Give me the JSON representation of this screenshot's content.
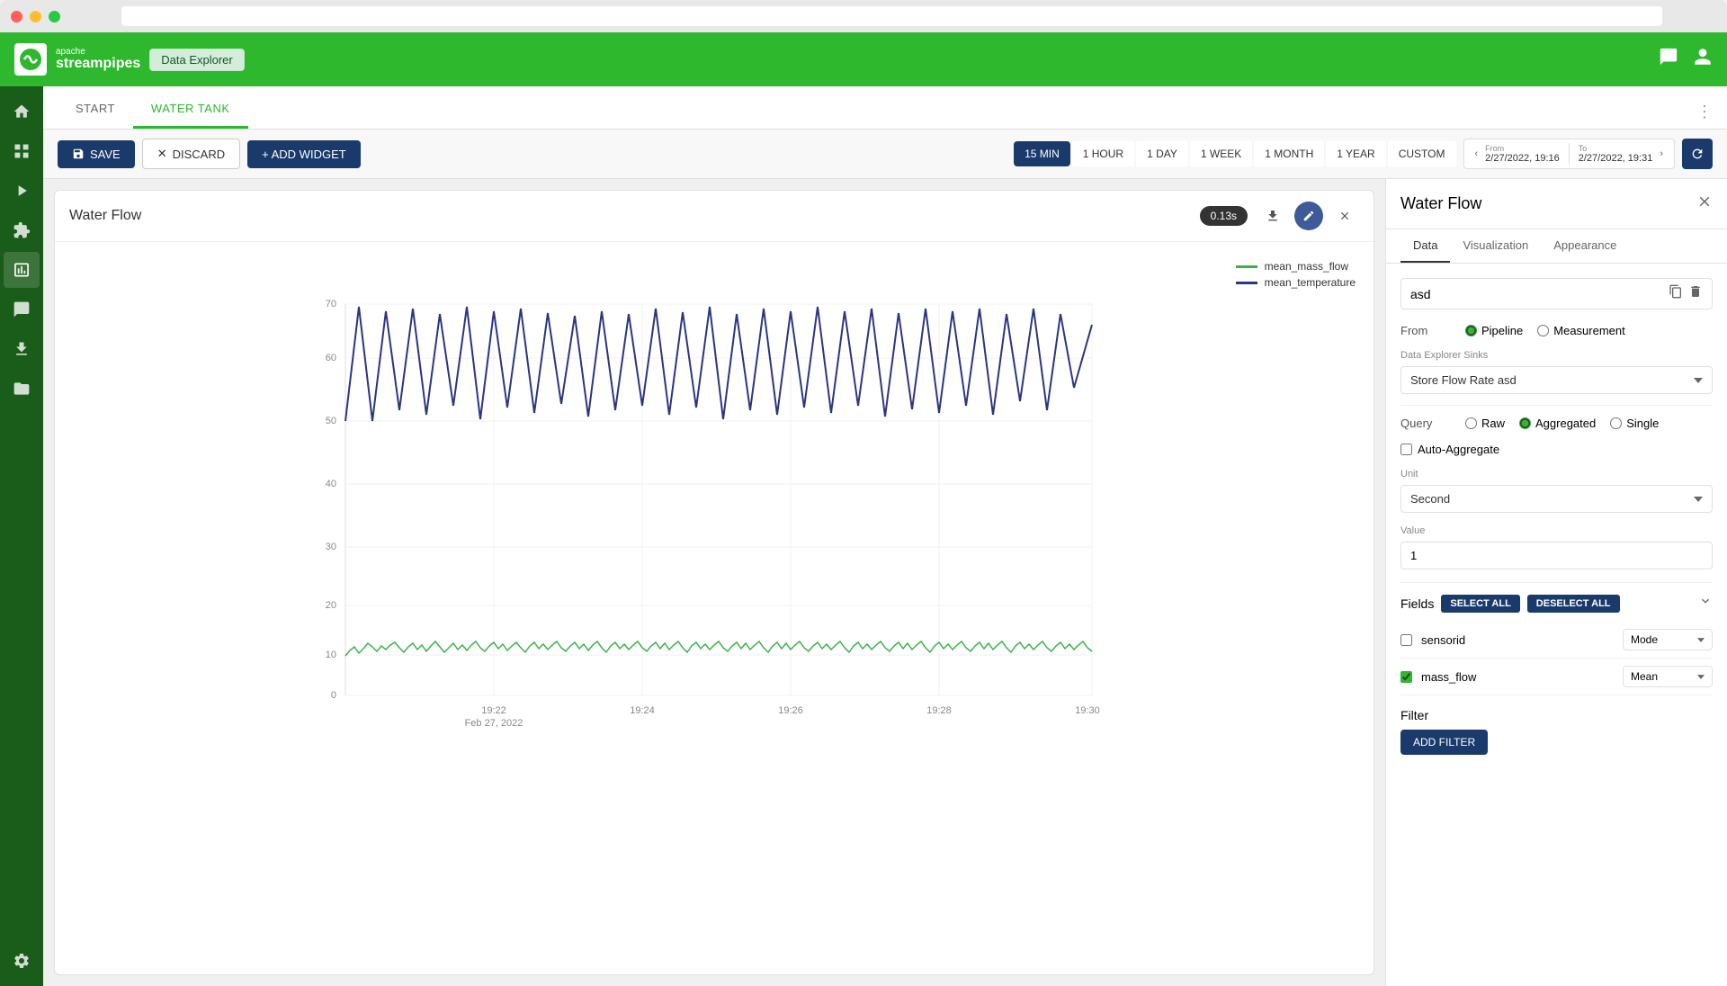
{
  "window": {
    "address": ""
  },
  "header": {
    "logo_letter": "S",
    "logo_apache": "apache",
    "logo_streampipes": "streampipes",
    "nav_badge": "Data Explorer",
    "chat_icon": "💬",
    "user_icon": "👤"
  },
  "sidebar": {
    "items": [
      {
        "name": "home-icon",
        "icon": "⌂"
      },
      {
        "name": "grid-icon",
        "icon": "⊞"
      },
      {
        "name": "play-icon",
        "icon": "▶"
      },
      {
        "name": "plugin-icon",
        "icon": "⬡"
      },
      {
        "name": "chart-icon",
        "icon": "📊"
      },
      {
        "name": "message-icon",
        "icon": "💬"
      },
      {
        "name": "download-icon",
        "icon": "⬇"
      },
      {
        "name": "file-icon",
        "icon": "📁"
      },
      {
        "name": "settings-icon",
        "icon": "⚙"
      }
    ]
  },
  "tabs": {
    "items": [
      {
        "label": "START",
        "active": false
      },
      {
        "label": "WATER TANK",
        "active": true
      }
    ],
    "more_icon": "⋮"
  },
  "toolbar": {
    "save_label": "SAVE",
    "discard_label": "DISCARD",
    "add_widget_label": "+ ADD WIDGET",
    "time_buttons": [
      {
        "label": "15 MIN",
        "active": true
      },
      {
        "label": "1 HOUR",
        "active": false
      },
      {
        "label": "1 DAY",
        "active": false
      },
      {
        "label": "1 WEEK",
        "active": false
      },
      {
        "label": "1 MONTH",
        "active": false
      },
      {
        "label": "1 YEAR",
        "active": false
      },
      {
        "label": "CUSTOM",
        "active": false
      }
    ],
    "date_from_label": "From",
    "date_from": "2/27/2022, 19:16",
    "date_to_label": "To",
    "date_to": "2/27/2022, 19:31",
    "refresh_icon": "↻"
  },
  "widget": {
    "title": "Water Flow",
    "time_badge": "0.13s",
    "download_icon": "⬇",
    "edit_icon": "✎",
    "close_icon": "×",
    "legend": [
      {
        "label": "mean_mass_flow",
        "color": "#3cb34a"
      },
      {
        "label": "mean_temperature",
        "color": "#2b3582"
      }
    ],
    "chart": {
      "y_labels": [
        "70",
        "60",
        "50",
        "40",
        "30",
        "20",
        "10",
        "0"
      ],
      "x_labels": [
        "19:22\nFeb 27, 2022",
        "19:24",
        "19:26",
        "19:28",
        "19:30"
      ]
    }
  },
  "right_panel": {
    "title": "Water Flow",
    "close_icon": "×",
    "tabs": [
      "Data",
      "Visualization",
      "Appearance"
    ],
    "active_tab": "Data",
    "search_value": "asd",
    "copy_icon": "⧉",
    "delete_icon": "🗑",
    "from_label": "From",
    "from_options": [
      {
        "label": "Pipeline",
        "selected": true
      },
      {
        "label": "Measurement",
        "selected": false
      }
    ],
    "sink_label": "Data Explorer Sinks",
    "sink_value": "Store Flow Rate  asd",
    "query_label": "Query",
    "query_options": [
      {
        "label": "Raw",
        "selected": false
      },
      {
        "label": "Aggregated",
        "selected": true
      },
      {
        "label": "Single",
        "selected": false
      }
    ],
    "auto_aggregate_label": "Auto-Aggregate",
    "auto_aggregate_checked": false,
    "unit_label": "Unit",
    "unit_value": "Second",
    "value_label": "Value",
    "value_value": "1",
    "fields_label": "Fields",
    "select_all_label": "SELECT ALL",
    "deselect_all_label": "DESELECT ALL",
    "fields": [
      {
        "name": "sensorid",
        "checked": false,
        "aggregate": "Mode"
      },
      {
        "name": "mass_flow",
        "checked": true,
        "aggregate": "Mean"
      }
    ],
    "filter_label": "Filter",
    "add_filter_label": "ADD FILTER"
  }
}
